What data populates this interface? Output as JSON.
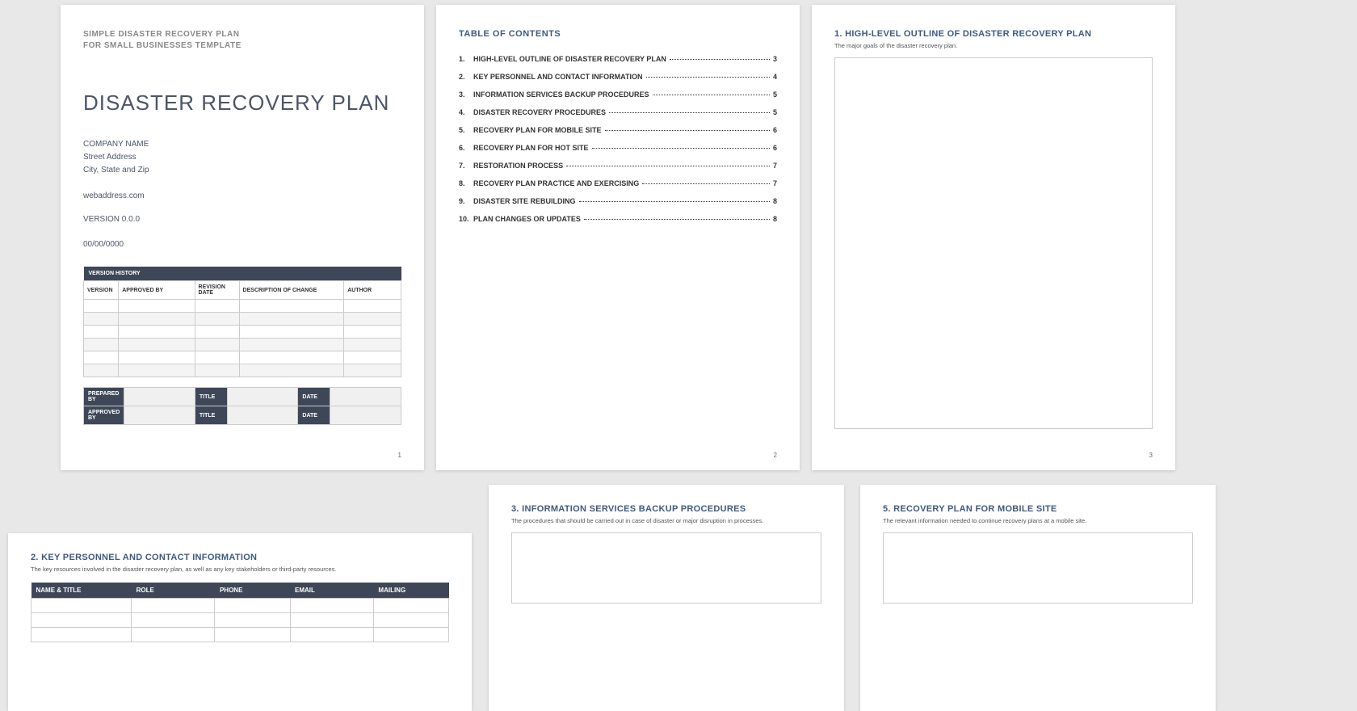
{
  "page1": {
    "template_line1": "SIMPLE DISASTER RECOVERY PLAN",
    "template_line2": "FOR SMALL BUSINESSES TEMPLATE",
    "title": "DISASTER RECOVERY PLAN",
    "company": "COMPANY NAME",
    "street": "Street Address",
    "city": "City, State and Zip",
    "web": "webaddress.com",
    "version": "VERSION 0.0.0",
    "date": "00/00/0000",
    "vh_header": "VERSION HISTORY",
    "vh_cols": {
      "c1": "VERSION",
      "c2": "APPROVED BY",
      "c3": "REVISION DATE",
      "c4": "DESCRIPTION OF CHANGE",
      "c5": "AUTHOR"
    },
    "sign": {
      "prepared": "PREPARED BY",
      "approved": "APPROVED BY",
      "title": "TITLE",
      "date": "DATE"
    },
    "page_num": "1"
  },
  "page2": {
    "title": "TABLE OF CONTENTS",
    "items": [
      {
        "n": "1.",
        "t": "HIGH-LEVEL OUTLINE OF DISASTER RECOVERY PLAN",
        "p": "3"
      },
      {
        "n": "2.",
        "t": "KEY PERSONNEL AND CONTACT INFORMATION",
        "p": "4"
      },
      {
        "n": "3.",
        "t": "INFORMATION SERVICES BACKUP PROCEDURES",
        "p": "5"
      },
      {
        "n": "4.",
        "t": "DISASTER RECOVERY PROCEDURES",
        "p": "5"
      },
      {
        "n": "5.",
        "t": "RECOVERY PLAN FOR MOBILE SITE",
        "p": "6"
      },
      {
        "n": "6.",
        "t": "RECOVERY PLAN FOR HOT SITE",
        "p": "6"
      },
      {
        "n": "7.",
        "t": "RESTORATION PROCESS",
        "p": "7"
      },
      {
        "n": "8.",
        "t": "RECOVERY PLAN PRACTICE AND EXERCISING",
        "p": "7"
      },
      {
        "n": "9.",
        "t": "DISASTER SITE REBUILDING",
        "p": "8"
      },
      {
        "n": "10.",
        "t": "PLAN CHANGES OR UPDATES",
        "p": "8"
      }
    ],
    "page_num": "2"
  },
  "page3": {
    "title": "1.  HIGH-LEVEL OUTLINE OF DISASTER RECOVERY PLAN",
    "desc": "The major goals of the disaster recovery plan.",
    "page_num": "3"
  },
  "page4": {
    "title": "2.  KEY PERSONNEL AND CONTACT INFORMATION",
    "desc": "The key resources involved in the disaster recovery plan, as well as any key stakeholders or third-party resources.",
    "cols": {
      "c1": "NAME & TITLE",
      "c2": "ROLE",
      "c3": "PHONE",
      "c4": "EMAIL",
      "c5": "MAILING"
    }
  },
  "page5": {
    "title": "3.  INFORMATION SERVICES BACKUP PROCEDURES",
    "desc": "The procedures that should be carried out in case of disaster or major disruption in processes."
  },
  "page6": {
    "title": "5.  RECOVERY PLAN FOR MOBILE SITE",
    "desc": "The relevant information needed to continue recovery plans at a mobile site."
  }
}
